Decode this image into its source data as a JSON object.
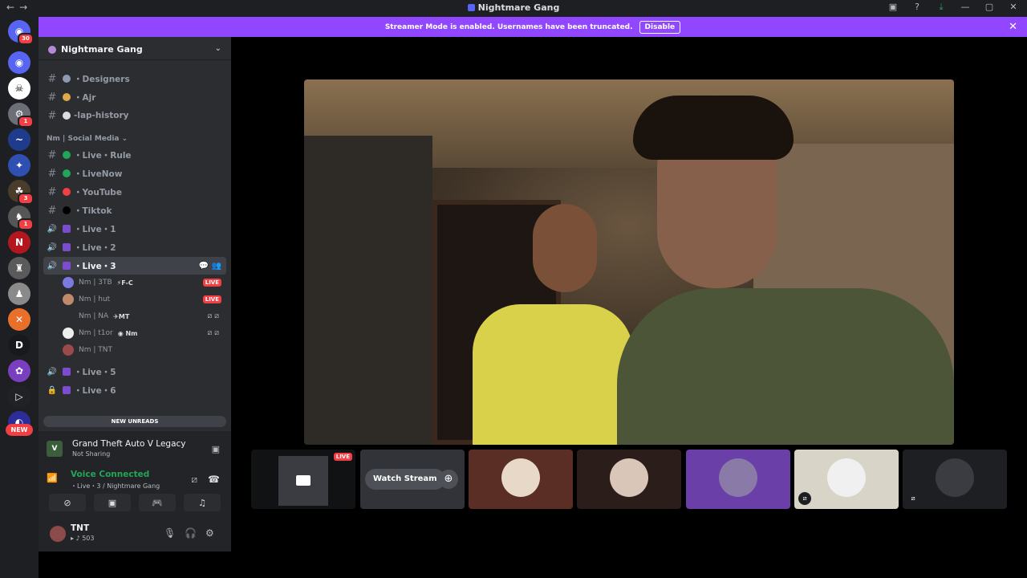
{
  "titlebar": {
    "title": "Nightmare Gang",
    "nav_back": "←",
    "nav_fwd": "→",
    "icons": [
      "inbox-icon",
      "help-icon",
      "download-icon",
      "minimize-icon",
      "maximize-icon",
      "close-icon"
    ],
    "icon_glyphs": [
      "▣",
      "?",
      "⤓",
      "—",
      "▢",
      "✕"
    ]
  },
  "banner": {
    "text": "Streamer Mode is enabled. Usernames have been truncated.",
    "disable": "Disable",
    "close": "✕"
  },
  "server_rail": {
    "home_badge": "30",
    "servers": [
      {
        "label": "◉",
        "color": "#5865f2",
        "badge": ""
      },
      {
        "label": "☠",
        "color": "#ffffff",
        "badge": ""
      },
      {
        "label": "⚙",
        "color": "#6c6f78",
        "badge": "1"
      },
      {
        "label": "~",
        "color": "#1f3c8c",
        "badge": ""
      },
      {
        "label": "✦",
        "color": "#2f4fb3",
        "badge": ""
      },
      {
        "label": "☘",
        "color": "#4a3b2a",
        "badge": "3"
      },
      {
        "label": "♞",
        "color": "#565656",
        "badge": "1"
      },
      {
        "label": "N",
        "color": "#b3161e",
        "badge": ""
      },
      {
        "label": "♜",
        "color": "#5a5a5a",
        "badge": ""
      },
      {
        "label": "♟",
        "color": "#8a8a8a",
        "badge": ""
      },
      {
        "label": "✕",
        "color": "#e9702a",
        "badge": ""
      },
      {
        "label": "D",
        "color": "#18191c",
        "badge": ""
      },
      {
        "label": "✿",
        "color": "#7a3fc0",
        "badge": ""
      },
      {
        "label": "▷",
        "color": "#202225",
        "badge": ""
      },
      {
        "label": "◐",
        "color": "#2b2d99",
        "badge": ""
      }
    ],
    "new_label": "NEW"
  },
  "server": {
    "name": "Nightmare Gang"
  },
  "channels_top": [
    {
      "name": "・Designers",
      "emoji_color": "#8d9bb1"
    },
    {
      "name": "・Ajr",
      "emoji_color": "#e0a84a"
    },
    {
      "name": "-lap-history",
      "emoji_color": "#dbdee1"
    }
  ],
  "category_social": "Nm | Social Media ⌄",
  "channels_social": [
    {
      "name": "・Live・Rule",
      "emoji_color": "#23a559",
      "type": "text"
    },
    {
      "name": "・LiveNow",
      "emoji_color": "#23a559",
      "type": "text"
    },
    {
      "name": "・YouTube",
      "emoji_color": "#f23f43",
      "type": "text"
    },
    {
      "name": "・Tiktok",
      "emoji_color": "#000000",
      "type": "text"
    },
    {
      "name": "・Live・1",
      "emoji_color": "#7b4ccc",
      "type": "voice"
    },
    {
      "name": "・Live・2",
      "emoji_color": "#7b4ccc",
      "type": "voice"
    },
    {
      "name": "・Live・3",
      "emoji_color": "#7b4ccc",
      "type": "voice",
      "active": true
    }
  ],
  "voice_users": [
    {
      "name": "Nm | 3TB",
      "tag": "⚡F-C",
      "status": "LIVE",
      "avatar_color": "#7a7ae0"
    },
    {
      "name": "Nm | hut",
      "tag": "",
      "status": "LIVE",
      "avatar_color": "#c08a6a"
    },
    {
      "name": "Nm | NA",
      "tag": "✈MT",
      "status": "muted",
      "avatar_color": "#2b2d31"
    },
    {
      "name": "Nm | t1or",
      "tag": "◉ Nm",
      "status": "muted",
      "avatar_color": "#eeeeee"
    },
    {
      "name": "Nm | TNT",
      "tag": "",
      "status": "",
      "avatar_color": "#9b4a4a"
    }
  ],
  "channels_bottom": [
    {
      "name": "・Live・5",
      "emoji_color": "#7b4ccc",
      "type": "voice"
    },
    {
      "name": "・Live・6",
      "emoji_color": "#7b4ccc",
      "type": "locked"
    }
  ],
  "new_unreads": "NEW UNREADS",
  "activity": {
    "game_name": "Grand Theft Auto V Legacy",
    "game_status": "Not Sharing",
    "voice_title": "Voice Connected",
    "voice_channel": "・Live・3 / Nightmare Gang"
  },
  "user": {
    "name": "TNT",
    "status": "503"
  },
  "tiles": [
    {
      "kind": "screen",
      "live": "LIVE"
    },
    {
      "kind": "watch",
      "label": "Watch Stream"
    },
    {
      "kind": "avatar",
      "bg": "#5a2e25",
      "av": "#e8d8c8"
    },
    {
      "kind": "avatar",
      "bg": "#2b1d19",
      "av": "#d9c6b8"
    },
    {
      "kind": "avatar",
      "bg": "#6a3fa8",
      "av": "#8a7aa8"
    },
    {
      "kind": "avatar",
      "bg": "#d8d4c8",
      "av": "#f0f0f0"
    },
    {
      "kind": "avatar",
      "bg": "#1e1f22",
      "av": "#3a3c42"
    }
  ]
}
